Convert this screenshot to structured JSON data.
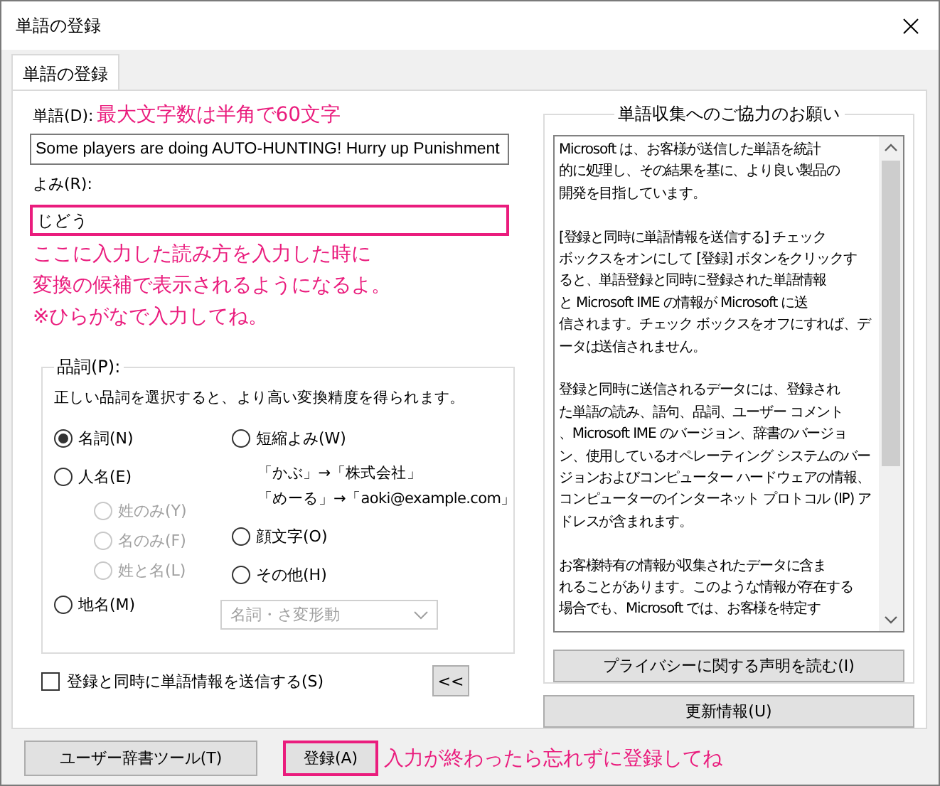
{
  "window": {
    "title": "単語の登録"
  },
  "tabs": [
    {
      "label": "単語の登録",
      "selected": true
    }
  ],
  "word": {
    "label": "単語(D):",
    "note": "最大文字数は半角で60文字",
    "value": "Some players are doing AUTO-HUNTING! Hurry up Punishment"
  },
  "reading": {
    "label": "よみ(R):",
    "value": "じどう",
    "highlighted": true
  },
  "annotation_lines": [
    "ここに入力した読み方を入力した時に",
    "変換の候補で表示されるようになるよ。",
    "※ひらがなで入力してね。"
  ],
  "part_of_speech": {
    "label": "品詞(P):",
    "hint": "正しい品詞を選択すると、より高い変換精度を得られます。",
    "left_options": [
      {
        "kind": "radio",
        "label": "名詞(N)",
        "selected": true,
        "disabled": false
      },
      {
        "kind": "radio",
        "label": "人名(E)",
        "selected": false,
        "disabled": false,
        "children": [
          {
            "kind": "radio",
            "label": "姓のみ(Y)",
            "selected": false,
            "disabled": true
          },
          {
            "kind": "radio",
            "label": "名のみ(F)",
            "selected": false,
            "disabled": true
          },
          {
            "kind": "radio",
            "label": "姓と名(L)",
            "selected": false,
            "disabled": true
          }
        ]
      },
      {
        "kind": "radio",
        "label": "地名(M)",
        "selected": false,
        "disabled": false
      }
    ],
    "right_options": [
      {
        "kind": "radio",
        "label": "短縮よみ(W)",
        "selected": false,
        "disabled": false
      },
      {
        "kind": "examples",
        "lines": [
          "「かぶ」→「株式会社」",
          "「めーる」→「aoki@example.com」"
        ]
      },
      {
        "kind": "radio",
        "label": "顔文字(O)",
        "selected": false,
        "disabled": false
      },
      {
        "kind": "radio",
        "label": "その他(H)",
        "selected": false,
        "disabled": false
      }
    ],
    "dropdown": {
      "value": "名詞・さ変形動",
      "disabled": true
    }
  },
  "send_checkbox": {
    "label": "登録と同時に単語情報を送信する(S)",
    "checked": false
  },
  "collapse_button": "<<",
  "collaboration": {
    "title": "単語収集へのご協力のお願い",
    "paragraphs": [
      [
        "Microsoft は、お客様が送信した単語を統計",
        "的に処理し、その結果を基に、より良い製品の",
        "開発を目指しています。"
      ],
      [
        "[登録と同時に単語情報を送信する] チェック",
        "ボックスをオンにして [登録] ボタンをクリックす",
        "ると、単語登録と同時に登録された単語情報",
        "と Microsoft IME の情報が Microsoft に送",
        "信されます。チェック ボックスをオフにすれば、デ",
        "ータは送信されません。"
      ],
      [
        "登録と同時に送信されるデータには、登録され",
        "た単語の読み、語句、品詞、ユーザー コメント",
        "、Microsoft IME のバージョン、辞書のバージョ",
        "ン、使用しているオペレーティング システムのバー",
        "ジョンおよびコンピューター ハードウェアの情報、",
        "コンピューターのインターネット プロトコル (IP) ア",
        "ドレスが含まれます。"
      ],
      [
        "お客様特有の情報が収集されたデータに含ま",
        "れることがあります。このような情報が存在する",
        "場合でも、Microsoft では、お客様を特定す"
      ]
    ],
    "privacy_button": "プライバシーに関する声明を読む(I)"
  },
  "update_button": "更新情報(U)",
  "footer": {
    "user_dictionary_button": "ユーザー辞書ツール(T)",
    "register_button": {
      "label": "登録(A)",
      "highlighted": true
    },
    "note": "入力が終わったら忘れずに登録してね"
  }
}
